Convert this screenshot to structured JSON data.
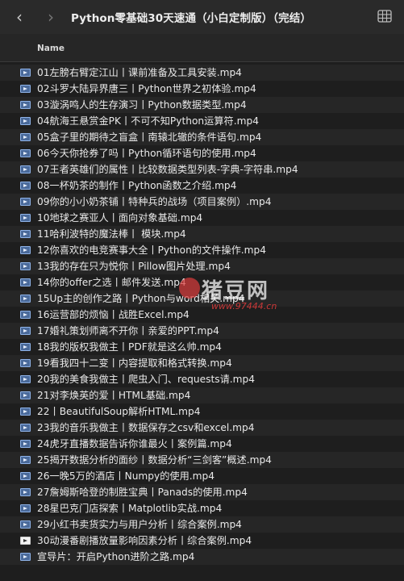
{
  "window": {
    "title": "Python零基础30天速通（小白定制版）（完结）"
  },
  "nav": {
    "back": "‹",
    "forward": "›"
  },
  "header": {
    "column_name": "Name"
  },
  "files": [
    {
      "name": "01左膀右臂定江山丨课前准备及工具安装.mp4",
      "icon": "video-file-icon"
    },
    {
      "name": "02斗罗大陆异界唐三丨Python世界之初体验.mp4",
      "icon": "video-file-icon"
    },
    {
      "name": "03漩涡鸣人的生存演习丨Python数据类型.mp4",
      "icon": "video-file-icon"
    },
    {
      "name": "04航海王悬赏金PK丨不可不知Python运算符.mp4",
      "icon": "video-file-icon"
    },
    {
      "name": "05盒子里的期待之盲盒丨南辕北辙的条件语句.mp4",
      "icon": "video-file-icon"
    },
    {
      "name": "06今天你抢券了吗丨Python循环语句的使用.mp4",
      "icon": "video-file-icon"
    },
    {
      "name": "07王者英雄们的属性丨比较数据类型列表-字典-字符串.mp4",
      "icon": "video-file-icon"
    },
    {
      "name": "08一杯奶茶的制作丨Python函数之介绍.mp4",
      "icon": "video-file-icon"
    },
    {
      "name": "09你的小小奶茶铺丨特种兵的战场（项目案例）.mp4",
      "icon": "video-file-icon"
    },
    {
      "name": "10地球之赛亚人丨面向对象基础.mp4",
      "icon": "video-file-icon"
    },
    {
      "name": "11哈利波特的魔法棒丨 模块.mp4",
      "icon": "video-file-icon"
    },
    {
      "name": "12你喜欢的电竞赛事大全丨Python的文件操作.mp4",
      "icon": "video-file-icon"
    },
    {
      "name": "13我的存在只为悦你丨Pillow图片处理.mp4",
      "icon": "video-file-icon"
    },
    {
      "name": "14你的offer之选丨邮件发送.mp4",
      "icon": "video-file-icon"
    },
    {
      "name": "15Up主的创作之路丨Python与word相关.mp4",
      "icon": "video-file-icon"
    },
    {
      "name": "16运营部的烦恼丨战胜Excel.mp4",
      "icon": "video-file-icon"
    },
    {
      "name": "17婚礼策划师离不开你丨亲爱的PPT.mp4",
      "icon": "video-file-icon"
    },
    {
      "name": "18我的版权我做主丨PDF就是这么帅.mp4",
      "icon": "video-file-icon"
    },
    {
      "name": "19看我四十二变丨内容提取和格式转换.mp4",
      "icon": "video-file-icon"
    },
    {
      "name": "20我的美食我做主丨爬虫入门、requests请.mp4",
      "icon": "video-file-icon"
    },
    {
      "name": "21对李焕英的爱丨HTML基础.mp4",
      "icon": "video-file-icon"
    },
    {
      "name": "22丨BeautifulSoup解析HTML.mp4",
      "icon": "video-file-icon"
    },
    {
      "name": "23我的音乐我做主丨数据保存之csv和excel.mp4",
      "icon": "video-file-icon"
    },
    {
      "name": "24虎牙直播数据告诉你谁最火丨案例篇.mp4",
      "icon": "video-file-icon"
    },
    {
      "name": "25揭开数据分析的面纱丨数据分析“三剑客”概述.mp4",
      "icon": "video-file-icon"
    },
    {
      "name": "26一晚5万的酒店丨Numpy的使用.mp4",
      "icon": "video-file-icon"
    },
    {
      "name": "27詹姆斯哈登的制胜宝典丨Panads的使用.mp4",
      "icon": "video-file-icon"
    },
    {
      "name": "28星巴克门店探索丨Matplotlib实战.mp4",
      "icon": "video-file-icon"
    },
    {
      "name": "29小红书卖货实力与用户分析丨综合案例.mp4",
      "icon": "video-file-icon"
    },
    {
      "name": "30动漫番剧播放量影响因素分析丨综合案例.mp4",
      "icon": "video-file-icon-light"
    },
    {
      "name": "宣导片：开启Python进阶之路.mp4",
      "icon": "video-file-icon"
    }
  ],
  "watermark": {
    "text": "猪豆网",
    "url": "www.97444.cn"
  },
  "colors": {
    "background": "#1e1e1e",
    "row_alt": "#262626",
    "titlebar": "#2a2a2a",
    "text": "#e9e9e9",
    "icon_blue": "#4a6a9a"
  }
}
